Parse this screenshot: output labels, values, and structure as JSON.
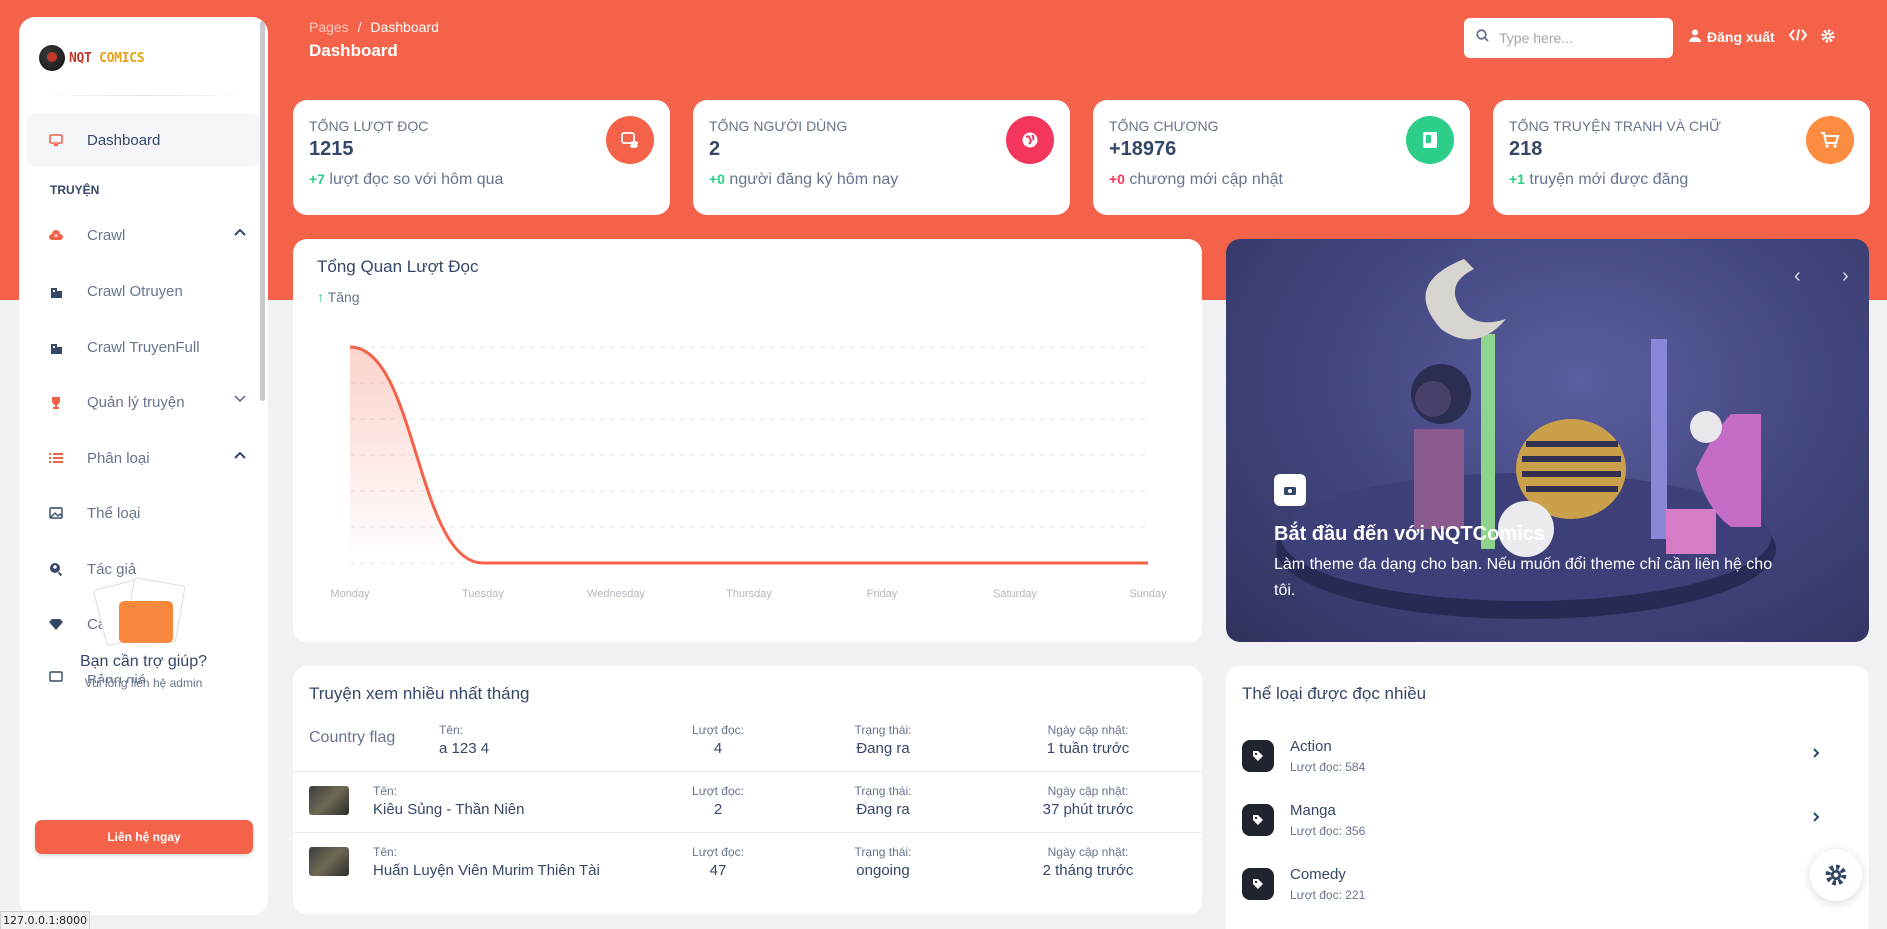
{
  "brand": {
    "logo_a": "NQT",
    "logo_b": "COMICS"
  },
  "sidebar": {
    "dashboard": "Dashboard",
    "section": "TRUYỆN",
    "items": [
      {
        "label": "Crawl",
        "icon": "cloud-upload-icon"
      },
      {
        "label": "Crawl Otruyen",
        "icon": "building-icon"
      },
      {
        "label": "Crawl TruyenFull",
        "icon": "building-icon"
      },
      {
        "label": "Quản lý truyện",
        "icon": "trophy-icon"
      },
      {
        "label": "Phân loại",
        "icon": "list-icon"
      },
      {
        "label": "Thể loại",
        "icon": "image-icon"
      },
      {
        "label": "Tác giả",
        "icon": "search-person-icon"
      },
      {
        "label": "Cấp bậc",
        "icon": "diamond-icon"
      },
      {
        "label": "Bảng giá",
        "icon": "card-icon"
      }
    ],
    "help_title": "Bạn cần trợ giúp?",
    "help_sub": "Vui lòng liên hệ admin",
    "help_button": "Liên hệ ngay"
  },
  "header": {
    "crumb_root": "Pages",
    "crumb_sep": "/",
    "crumb_current": "Dashboard",
    "title": "Dashboard",
    "search_placeholder": "Type here...",
    "logout": "Đăng xuất"
  },
  "stats": [
    {
      "label": "Tổng lượt đọc",
      "value": "1215",
      "delta": "+7",
      "delta_text": " lượt đọc so với hôm qua",
      "color": "#f4624a"
    },
    {
      "label": "Tổng người dùng",
      "value": "2",
      "delta": "+0",
      "delta_text": " người đăng ký hôm nay",
      "color": "#f5365c"
    },
    {
      "label": "Tổng chương",
      "value": "+18976",
      "delta": "+0",
      "delta_text": " chương mới cập nhật",
      "color": "#2dce89"
    },
    {
      "label": "Tổng truyện tranh và chữ",
      "value": "218",
      "delta": "+1",
      "delta_text": " truyện mới được đăng",
      "color": "#fb8c40"
    }
  ],
  "chart": {
    "title": "Tổng Quan Lượt Đọc",
    "trend": "Tăng"
  },
  "chart_data": {
    "type": "area",
    "categories": [
      "Monday",
      "Tuesday",
      "Wednesday",
      "Thursday",
      "Friday",
      "Saturday",
      "Sunday"
    ],
    "values": [
      7,
      0,
      0,
      0,
      0,
      0,
      0
    ],
    "ylim": [
      0,
      7
    ],
    "grid": true,
    "color": "#f4624a"
  },
  "carousel": {
    "title": "Bắt đầu đến với NQTComics",
    "desc": "Làm theme đa dạng cho bạn. Nếu muốn đổi theme chỉ cần liên hệ cho tôi.",
    "prev": "‹",
    "next": "›"
  },
  "top_comics": {
    "title": "Truyện xem nhiều nhất tháng",
    "col_name": "Tên:",
    "col_reads": "Lượt đọc:",
    "col_status": "Trạng thái:",
    "col_updated": "Ngày cập nhật:",
    "flag_alt": "Country flag",
    "rows": [
      {
        "name": "a 123 4",
        "reads": "4",
        "status": "Đang ra",
        "updated": "1 tuần trước"
      },
      {
        "name": "Kiêu Sủng - Thần Niên",
        "reads": "2",
        "status": "Đang ra",
        "updated": "37 phút trước"
      },
      {
        "name": "Huấn Luyện Viên Murim Thiên Tài",
        "reads": "47",
        "status": "ongoing",
        "updated": "2 tháng trước"
      }
    ]
  },
  "categories": {
    "title": "Thể loại được đọc nhiều",
    "items": [
      {
        "name": "Action",
        "count": "Lượt đọc: 584"
      },
      {
        "name": "Manga",
        "count": "Lượt đọc: 356"
      },
      {
        "name": "Comedy",
        "count": "Lượt đọc: 221"
      }
    ]
  },
  "status_bar": "127.0.0.1:8000"
}
